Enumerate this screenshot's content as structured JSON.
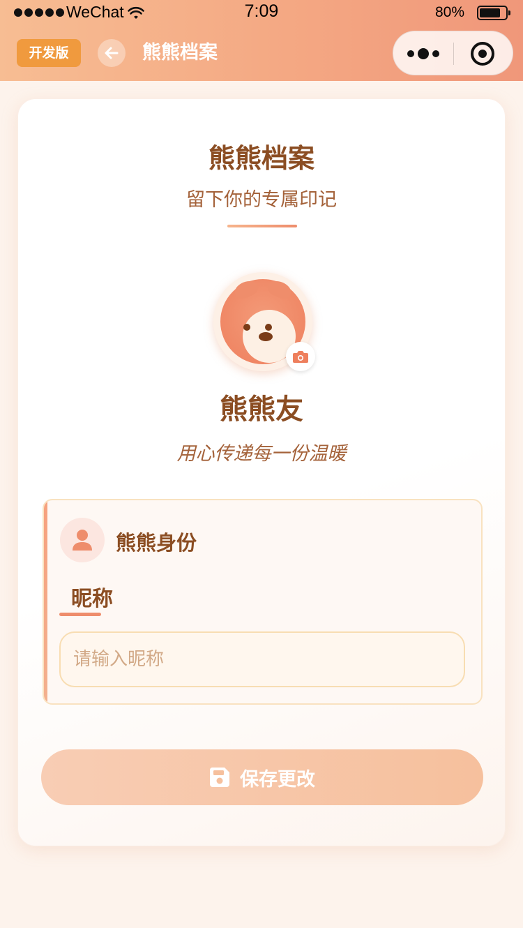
{
  "status_bar": {
    "carrier": "WeChat",
    "time": "7:09",
    "battery_percent": "80%",
    "battery_level": 0.8
  },
  "nav": {
    "dev_badge": "开发版",
    "title": "熊熊档案",
    "icons": {
      "back": "arrow-left-icon",
      "more": "more-dots-icon",
      "close": "target-icon"
    }
  },
  "profile": {
    "page_title": "熊熊档案",
    "page_subtitle": "留下你的专属印记",
    "display_name": "熊熊友",
    "motto": "用心传递每一份温暖",
    "avatar_icon": "bear-avatar-icon",
    "camera_icon": "camera-icon"
  },
  "identity_section": {
    "title": "熊熊身份",
    "icon": "user-icon",
    "field_label": "昵称",
    "nickname_value": "",
    "nickname_placeholder": "请输入昵称"
  },
  "actions": {
    "save_label": "保存更改",
    "save_icon": "floppy-disk-icon"
  },
  "colors": {
    "header_start": "#f7bd93",
    "header_end": "#f0977a",
    "text_brown": "#8b4d22",
    "accent_coral": "#ee8d6c",
    "dev_badge": "#f09a3e",
    "save_button": "#f6c09d"
  }
}
